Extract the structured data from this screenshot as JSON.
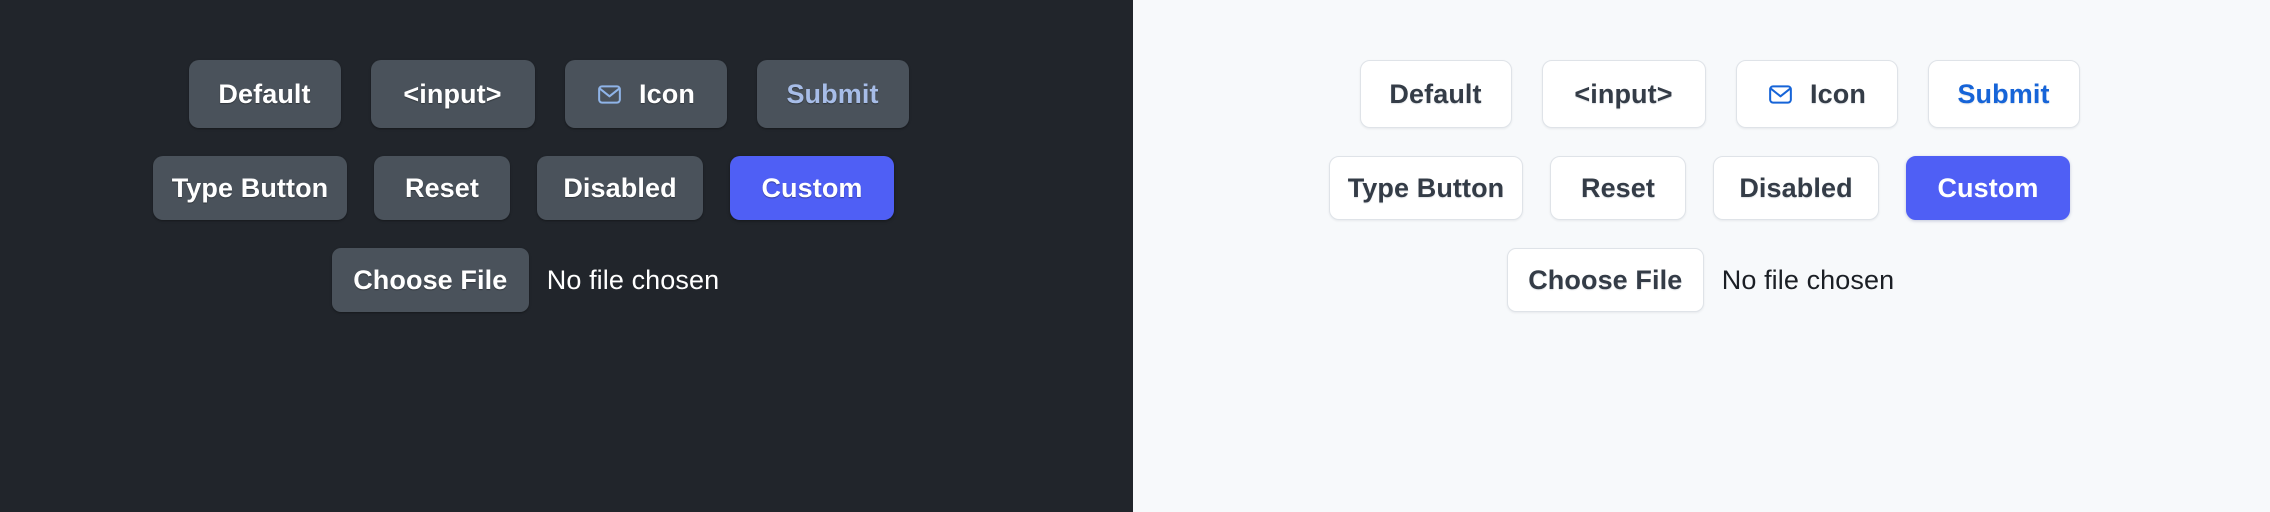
{
  "panels": [
    {
      "theme": "dark",
      "background": "#21252b",
      "row1": [
        {
          "label": "Default"
        },
        {
          "label": "<input>"
        },
        {
          "label": "Icon",
          "icon": "mail-envelope-icon"
        },
        {
          "label": "Submit"
        }
      ],
      "row2": [
        {
          "label": "Type Button"
        },
        {
          "label": "Reset"
        },
        {
          "label": "Disabled"
        },
        {
          "label": "Custom"
        }
      ],
      "file": {
        "button_label": "Choose File",
        "status_text": "No file chosen"
      },
      "colors": {
        "button_fill": "#4a525b",
        "button_text": "#ffffff",
        "submit_text": "#a7bde8",
        "custom_fill": "#4f5ff5",
        "custom_text": "#ffffff",
        "icon_stroke": "#8fb4e8"
      }
    },
    {
      "theme": "light",
      "background": "#f7f9fb",
      "row1": [
        {
          "label": "Default"
        },
        {
          "label": "<input>"
        },
        {
          "label": "Icon",
          "icon": "mail-envelope-icon"
        },
        {
          "label": "Submit"
        }
      ],
      "row2": [
        {
          "label": "Type Button"
        },
        {
          "label": "Reset"
        },
        {
          "label": "Disabled"
        },
        {
          "label": "Custom"
        }
      ],
      "file": {
        "button_label": "Choose File",
        "status_text": "No file chosen"
      },
      "colors": {
        "button_fill": "#ffffff",
        "button_border": "#dfe3e8",
        "button_text": "#343c47",
        "submit_text": "#1664d8",
        "custom_fill": "#4f5ff5",
        "custom_text": "#ffffff",
        "icon_stroke": "#1664d8"
      }
    }
  ]
}
